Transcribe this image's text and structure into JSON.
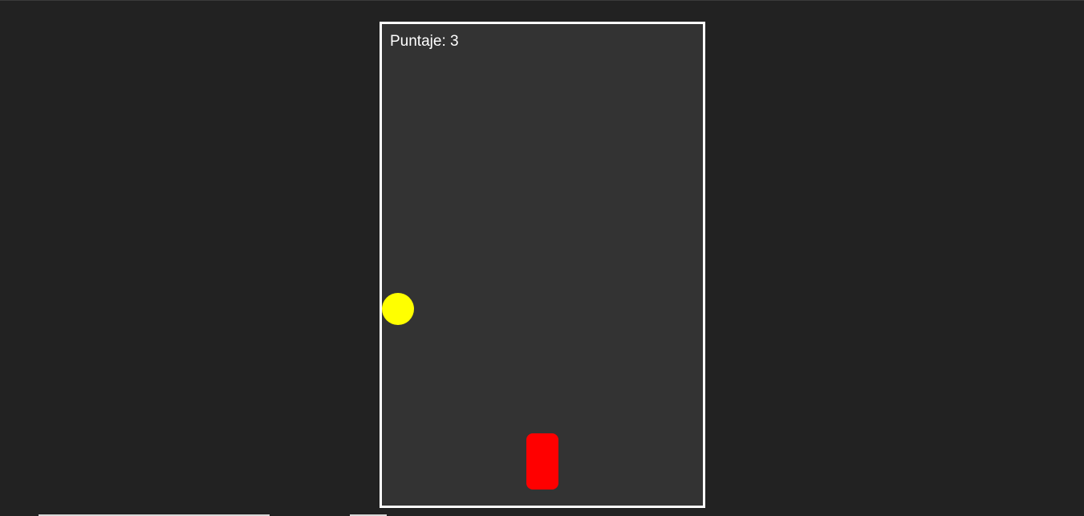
{
  "game": {
    "score_label": "Puntaje: 3",
    "score": 3
  },
  "colors": {
    "background": "#222222",
    "board": "#333333",
    "board_border": "#ffffff",
    "ball": "#ffff00",
    "player": "#ff0000",
    "text": "#ffffff"
  },
  "icons": {
    "ball": "yellow-circle",
    "player": "red-rounded-rectangle"
  }
}
